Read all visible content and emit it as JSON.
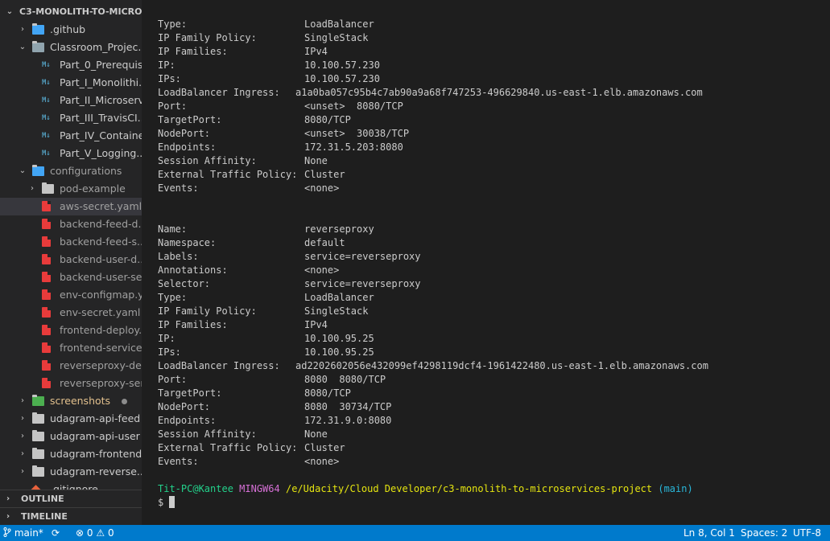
{
  "explorer": {
    "root_label": "C3-MONOLITH-TO-MICRO...",
    "items": [
      {
        "label": ".github",
        "depth": 1,
        "chevron": "›",
        "icon": "special-folder"
      },
      {
        "label": "Classroom_Projec...",
        "depth": 1,
        "chevron": "⌄",
        "icon": "folder-open"
      },
      {
        "label": "Part_0_Prerequis...",
        "depth": 2,
        "icon": "markdown"
      },
      {
        "label": "Part_I_Monolithi...",
        "depth": 2,
        "icon": "markdown"
      },
      {
        "label": "Part_II_Microserv...",
        "depth": 2,
        "icon": "markdown"
      },
      {
        "label": "Part_III_TravisCI....",
        "depth": 2,
        "icon": "markdown"
      },
      {
        "label": "Part_IV_Containe...",
        "depth": 2,
        "icon": "markdown"
      },
      {
        "label": "Part_V_Logging....",
        "depth": 2,
        "icon": "markdown"
      },
      {
        "label": "configurations",
        "depth": 1,
        "chevron": "⌄",
        "icon": "special-folder",
        "dim": true
      },
      {
        "label": "pod-example",
        "depth": 2,
        "chevron": "›",
        "icon": "folder",
        "dim": true
      },
      {
        "label": "aws-secret.yaml",
        "depth": 2,
        "icon": "yaml",
        "dim": true,
        "selected": true
      },
      {
        "label": "backend-feed-d...",
        "depth": 2,
        "icon": "yaml",
        "dim": true
      },
      {
        "label": "backend-feed-s...",
        "depth": 2,
        "icon": "yaml",
        "dim": true
      },
      {
        "label": "backend-user-d...",
        "depth": 2,
        "icon": "yaml",
        "dim": true
      },
      {
        "label": "backend-user-se...",
        "depth": 2,
        "icon": "yaml",
        "dim": true
      },
      {
        "label": "env-configmap.y...",
        "depth": 2,
        "icon": "yaml",
        "dim": true
      },
      {
        "label": "env-secret.yaml",
        "depth": 2,
        "icon": "yaml",
        "dim": true
      },
      {
        "label": "frontend-deploy...",
        "depth": 2,
        "icon": "yaml",
        "dim": true
      },
      {
        "label": "frontend-service...",
        "depth": 2,
        "icon": "yaml",
        "dim": true
      },
      {
        "label": "reverseproxy-de...",
        "depth": 2,
        "icon": "yaml",
        "dim": true
      },
      {
        "label": "reverseproxy-ser...",
        "depth": 2,
        "icon": "yaml",
        "dim": true
      },
      {
        "label": "screenshots",
        "depth": 1,
        "chevron": "›",
        "icon": "green-folder",
        "scm": true
      },
      {
        "label": "udagram-api-feed",
        "depth": 1,
        "chevron": "›",
        "icon": "folder"
      },
      {
        "label": "udagram-api-user",
        "depth": 1,
        "chevron": "›",
        "icon": "folder"
      },
      {
        "label": "udagram-frontend",
        "depth": 1,
        "chevron": "›",
        "icon": "folder"
      },
      {
        "label": "udagram-reverse...",
        "depth": 1,
        "chevron": "›",
        "icon": "folder"
      },
      {
        "label": ".gitignore",
        "depth": 1,
        "icon": "git"
      }
    ]
  },
  "panels": {
    "outline": "OUTLINE",
    "timeline": "TIMELINE"
  },
  "terminal": {
    "lines": [
      [
        "Type:",
        "LoadBalancer"
      ],
      [
        "IP Family Policy:",
        "SingleStack"
      ],
      [
        "IP Families:",
        "IPv4"
      ],
      [
        "IP:",
        "10.100.57.230"
      ],
      [
        "IPs:",
        "10.100.57.230"
      ],
      [
        "LoadBalancer Ingress:",
        "a1a0ba057c95b4c7ab90a9a68f747253-496629840.us-east-1.elb.amazonaws.com",
        "long"
      ],
      [
        "Port:",
        "<unset>  8080/TCP"
      ],
      [
        "TargetPort:",
        "8080/TCP"
      ],
      [
        "NodePort:",
        "<unset>  30038/TCP"
      ],
      [
        "Endpoints:",
        "172.31.5.203:8080"
      ],
      [
        "Session Affinity:",
        "None"
      ],
      [
        "External Traffic Policy:",
        "Cluster"
      ],
      [
        "Events:",
        "<none>"
      ],
      [
        "",
        ""
      ],
      [
        "",
        ""
      ],
      [
        "Name:",
        "reverseproxy"
      ],
      [
        "Namespace:",
        "default"
      ],
      [
        "Labels:",
        "service=reverseproxy"
      ],
      [
        "Annotations:",
        "<none>"
      ],
      [
        "Selector:",
        "service=reverseproxy"
      ],
      [
        "Type:",
        "LoadBalancer"
      ],
      [
        "IP Family Policy:",
        "SingleStack"
      ],
      [
        "IP Families:",
        "IPv4"
      ],
      [
        "IP:",
        "10.100.95.25"
      ],
      [
        "IPs:",
        "10.100.95.25"
      ],
      [
        "LoadBalancer Ingress:",
        "ad2202602056e432099ef4298119dcf4-1961422480.us-east-1.elb.amazonaws.com",
        "long"
      ],
      [
        "Port:",
        "8080  8080/TCP"
      ],
      [
        "TargetPort:",
        "8080/TCP"
      ],
      [
        "NodePort:",
        "8080  30734/TCP"
      ],
      [
        "Endpoints:",
        "172.31.9.0:8080"
      ],
      [
        "Session Affinity:",
        "None"
      ],
      [
        "External Traffic Policy:",
        "Cluster"
      ],
      [
        "Events:",
        "<none>"
      ]
    ],
    "prompt": {
      "user_host": "Tit-PC@Kantee",
      "shell": "MINGW64",
      "path": "/e/Udacity/Cloud Developer/c3-monolith-to-microservices-project",
      "branch": "(main)",
      "symbol": "$"
    }
  },
  "statusbar": {
    "branch": "main*",
    "errors": "0",
    "warnings": "0",
    "position": "Ln 8, Col 1",
    "spaces": "Spaces: 2",
    "encoding": "UTF-8"
  },
  "colors": {
    "statusbar_bg": "#007acc",
    "sidebar_bg": "#252526",
    "terminal_bg": "#1e1e1e",
    "prompt_user": "#23d18b",
    "prompt_shell": "#d670d6",
    "prompt_path": "#e5e510",
    "prompt_branch": "#29b8db"
  }
}
